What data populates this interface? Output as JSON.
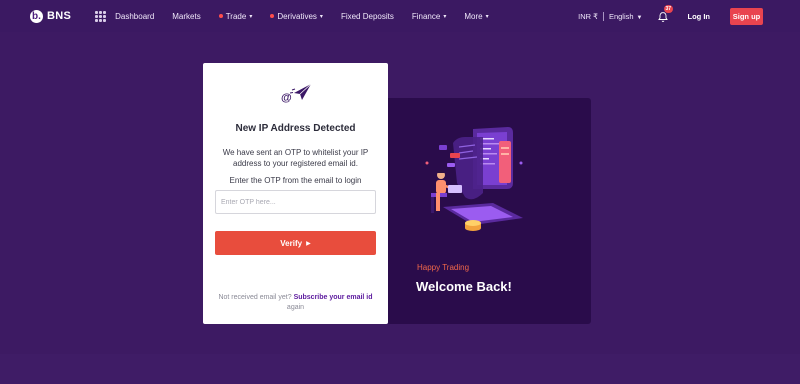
{
  "brand": {
    "logo_letter": "b.",
    "name": "BNS"
  },
  "nav": {
    "items": [
      {
        "label": "Dashboard",
        "dot": false,
        "caret": false
      },
      {
        "label": "Markets",
        "dot": false,
        "caret": false
      },
      {
        "label": "Trade",
        "dot": true,
        "caret": true
      },
      {
        "label": "Derivatives",
        "dot": true,
        "caret": true
      },
      {
        "label": "Fixed Deposits",
        "dot": false,
        "caret": false
      },
      {
        "label": "Finance",
        "dot": false,
        "caret": true
      },
      {
        "label": "More",
        "dot": false,
        "caret": true
      }
    ],
    "currency": "INR ₹",
    "language": "English",
    "notification_count": "37",
    "login_label": "Log In",
    "signup_label": "Sign up"
  },
  "otp_card": {
    "title": "New IP Address Detected",
    "description": "We have sent an OTP to whitelist your IP address to your registered email id.",
    "instruction": "Enter the OTP from the email to login",
    "input_placeholder": "Enter OTP here...",
    "input_value": "",
    "verify_label": "Verify",
    "resend_prefix": "Not received email yet?",
    "resend_link": "Subscribe your email id",
    "resend_suffix": "again"
  },
  "welcome_card": {
    "tagline": "Happy Trading",
    "heading": "Welcome Back!"
  },
  "colors": {
    "background": "#3d1a63",
    "accent_red": "#e84d3d",
    "link_purple": "#5c1a9e",
    "panel_dark": "#2a0c4b"
  }
}
